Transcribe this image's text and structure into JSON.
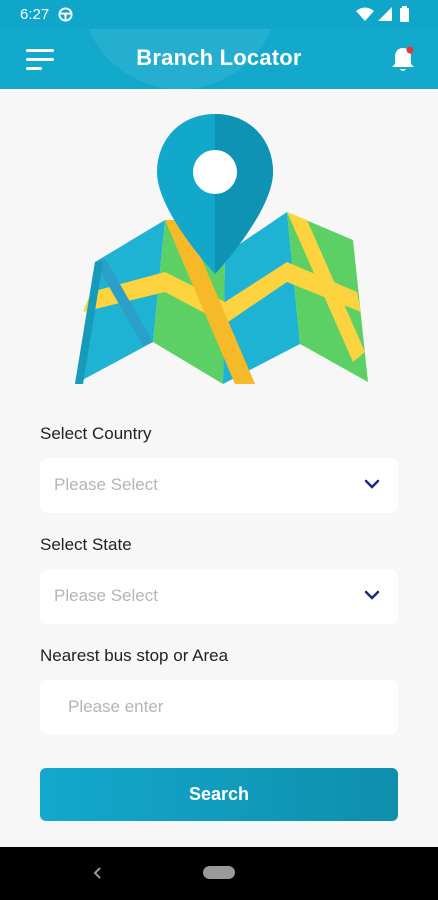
{
  "status_bar": {
    "time": "6:27"
  },
  "app_bar": {
    "title": "Branch Locator"
  },
  "form": {
    "country": {
      "label": "Select Country",
      "placeholder": "Please Select"
    },
    "state": {
      "label": "Select State",
      "placeholder": "Please Select"
    },
    "area": {
      "label": "Nearest bus stop or Area",
      "placeholder": "Please enter"
    },
    "search_label": "Search"
  },
  "colors": {
    "primary": "#12A9CC",
    "chevron": "#1E2A78",
    "notification_dot": "#E53935"
  }
}
